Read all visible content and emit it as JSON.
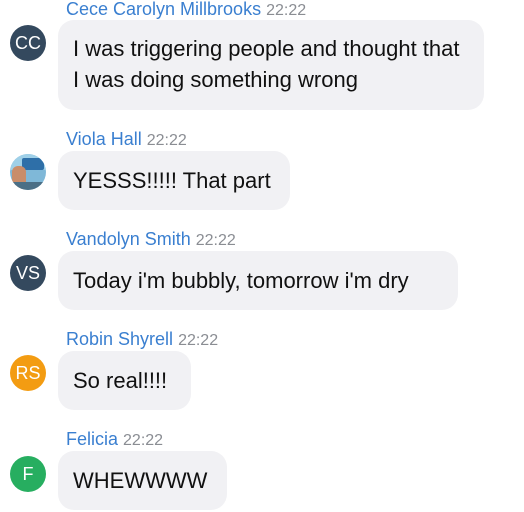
{
  "messages": [
    {
      "sender": "Cece Carolyn Millbrooks",
      "time": "22:22",
      "avatar_initials": "CC",
      "avatar_color": "#34495e",
      "text": "I was triggering people and thought that I was doing something wrong"
    },
    {
      "sender": "Viola Hall",
      "time": "22:22",
      "avatar_initials": "",
      "avatar_color": "#7fb8d8",
      "text": "YESSS!!!!! That part"
    },
    {
      "sender": "Vandolyn Smith",
      "time": "22:22",
      "avatar_initials": "VS",
      "avatar_color": "#34495e",
      "text": "Today i'm bubbly, tomorrow i'm dry"
    },
    {
      "sender": "Robin Shyrell",
      "time": "22:22",
      "avatar_initials": "RS",
      "avatar_color": "#f39c12",
      "text": "So real!!!!"
    },
    {
      "sender": "Felicia",
      "time": "22:22",
      "avatar_initials": "F",
      "avatar_color": "#27ae60",
      "text": "WHEWWWW"
    }
  ]
}
